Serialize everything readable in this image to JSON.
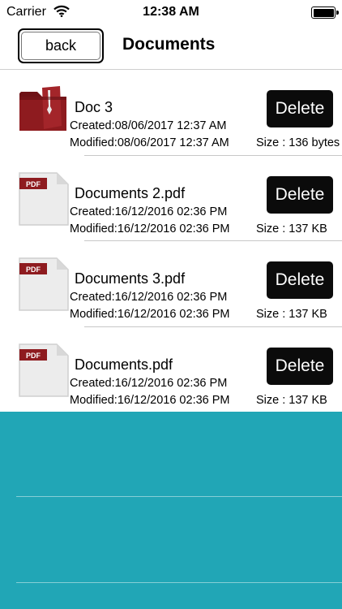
{
  "status": {
    "carrier": "Carrier",
    "time": "12:38 AM"
  },
  "nav": {
    "back_label": "back",
    "title": "Documents"
  },
  "documents": [
    {
      "icon": "folder-icon",
      "name": "Doc 3",
      "created": "Created:08/06/2017 12:37 AM",
      "modified": "Modified:08/06/2017 12:37 AM",
      "size": "Size : 136 bytes",
      "delete_label": "Delete"
    },
    {
      "icon": "pdf-file-icon",
      "name": "Documents 2.pdf",
      "created": "Created:16/12/2016 02:36 PM",
      "modified": "Modified:16/12/2016 02:36 PM",
      "size": "Size : 137 KB",
      "delete_label": "Delete"
    },
    {
      "icon": "pdf-file-icon",
      "name": "Documents 3.pdf",
      "created": "Created:16/12/2016 02:36 PM",
      "modified": "Modified:16/12/2016 02:36 PM",
      "size": "Size : 137 KB",
      "delete_label": "Delete"
    },
    {
      "icon": "pdf-file-icon",
      "name": "Documents.pdf",
      "created": "Created:16/12/2016 02:36 PM",
      "modified": "Modified:16/12/2016 02:36 PM",
      "size": "Size : 137 KB",
      "delete_label": "Delete"
    }
  ],
  "pdf_badge": "PDF",
  "colors": {
    "bottom_panel": "#21a6b6",
    "folder": "#8e1b1f",
    "delete_button": "#0b0b0b"
  }
}
